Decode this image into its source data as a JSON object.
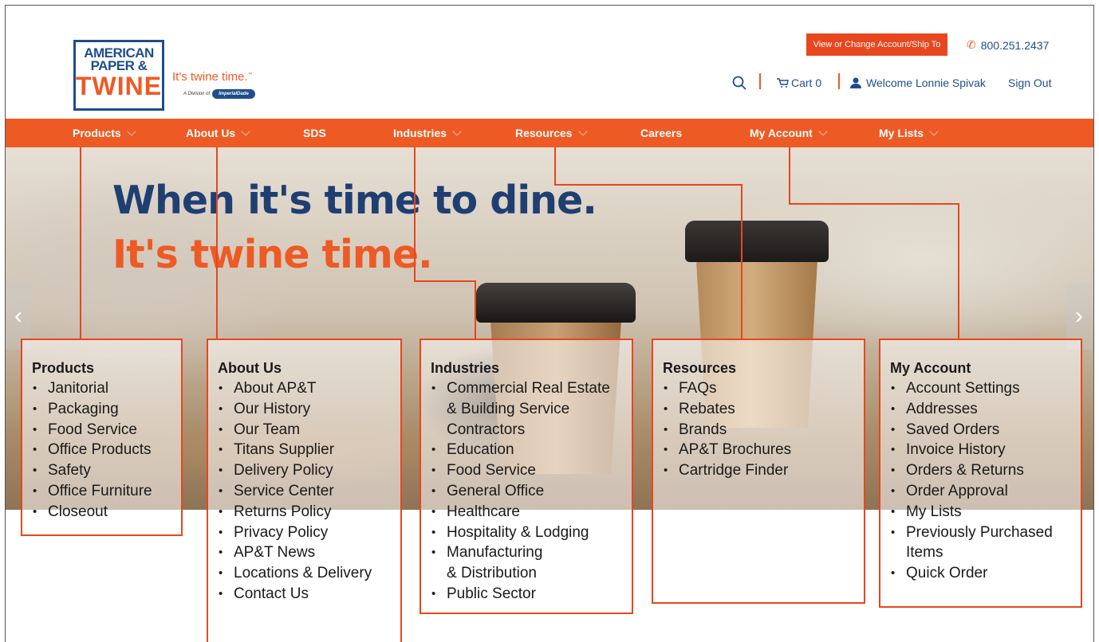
{
  "brand": {
    "logo_line1": "AMERICAN",
    "logo_line2": "PAPER &",
    "logo_line3": "TWINE",
    "tagline": "It's twine time.",
    "division_text": "A Division of",
    "parent_company": "ImperialDade"
  },
  "header": {
    "account_button": "View or Change Account/Ship To",
    "phone": "800.251.2437",
    "cart_label": "Cart 0",
    "welcome": "Welcome Lonnie Spivak",
    "sign_out": "Sign Out"
  },
  "nav": {
    "products": "Products",
    "about": "About Us",
    "sds": "SDS",
    "industries": "Industries",
    "resources": "Resources",
    "careers": "Careers",
    "my_account": "My Account",
    "my_lists": "My Lists"
  },
  "hero": {
    "line1": "When it's time to dine.",
    "line2": "It's twine time.",
    "prev": "‹",
    "next": "›"
  },
  "menus": {
    "products": {
      "title": "Products",
      "items": [
        "Janitorial",
        "Packaging",
        "Food Service",
        "Office Products",
        "Safety",
        "Office Furniture",
        "Closeout"
      ]
    },
    "about": {
      "title": "About Us",
      "items": [
        "About AP&T",
        "Our History",
        "Our Team",
        "Titans Supplier",
        "Delivery Policy",
        "Service Center",
        "Returns Policy",
        "Privacy Policy",
        "AP&T News",
        "Locations & Delivery",
        "Contact Us"
      ]
    },
    "industries": {
      "title": "Industries",
      "items": [
        "Commercial Real Estate\n& Building Service\nContractors",
        "Education",
        "Food Service",
        "General Office",
        "Healthcare",
        "Hospitality & Lodging",
        "Manufacturing\n& Distribution",
        "Public Sector"
      ]
    },
    "resources": {
      "title": "Resources",
      "items": [
        "FAQs",
        "Rebates",
        "Brands",
        "AP&T Brochures",
        "Cartridge Finder"
      ]
    },
    "my_account": {
      "title": "My Account",
      "items": [
        "Account Settings",
        "Addresses",
        "Saved Orders",
        "Invoice History",
        "Orders & Returns",
        "Order Approval",
        "My Lists",
        "Previously Purchased\nItems",
        "Quick Order"
      ]
    }
  }
}
